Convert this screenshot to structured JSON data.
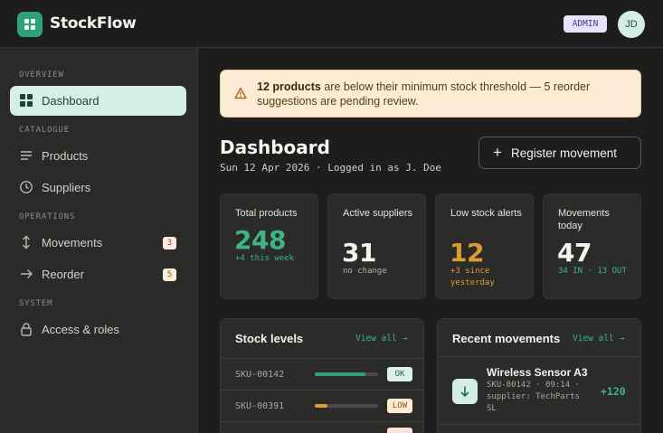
{
  "app": {
    "name": "StockFlow",
    "role_badge": "ADMIN",
    "user_initials": "JD"
  },
  "sidebar": {
    "sections": [
      "OVERVIEW",
      "CATALOGUE",
      "OPERATIONS",
      "SYSTEM"
    ],
    "items": [
      {
        "label": "Dashboard",
        "icon": "grid-icon",
        "active": true
      },
      {
        "label": "Products",
        "icon": "list-icon"
      },
      {
        "label": "Suppliers",
        "icon": "clock-icon"
      },
      {
        "label": "Movements",
        "icon": "arrows-updown-icon",
        "badge": "3"
      },
      {
        "label": "Reorder",
        "icon": "arrow-right-icon",
        "badge": "5"
      },
      {
        "label": "Access & roles",
        "icon": "lock-icon"
      }
    ]
  },
  "alert": {
    "bold": "12 products",
    "text": " are below their minimum stock threshold — 5 reorder suggestions are pending review."
  },
  "page": {
    "title": "Dashboard",
    "subtitle": "Sun 12 Apr 2026 · Logged in as J. Doe",
    "register_button": "Register movement"
  },
  "stats": [
    {
      "label": "Total products",
      "value": "248",
      "note": "+4 this week",
      "color": "#3fb488"
    },
    {
      "label": "Active suppliers",
      "value": "31",
      "note": "no change",
      "color": "#f4f4f0"
    },
    {
      "label": "Low stock alerts",
      "value": "12",
      "note": "+3 since yesterday",
      "color": "#e09a35"
    },
    {
      "label": "Movements today",
      "value": "47",
      "note": "34 IN · 13 OUT",
      "color": "#f4f4f0"
    }
  ],
  "stock_levels": {
    "title": "Stock levels",
    "view_all": "View all →",
    "rows": [
      {
        "sku": "SKU-00142",
        "level": 0.8,
        "status": "OK"
      },
      {
        "sku": "SKU-00391",
        "level": 0.2,
        "status": "LOW"
      }
    ]
  },
  "recent_movements": {
    "title": "Recent movements",
    "view_all": "View all →",
    "items": [
      {
        "name": "Wireless Sensor A3",
        "meta": "SKU-00142 · 09:14 · supplier: TechParts SL",
        "qty": "+120",
        "direction": "in"
      }
    ]
  },
  "colors": {
    "accent": "#2ea37a",
    "ok": "#3fb488",
    "warn": "#e09a35",
    "danger": "#d25a45"
  }
}
